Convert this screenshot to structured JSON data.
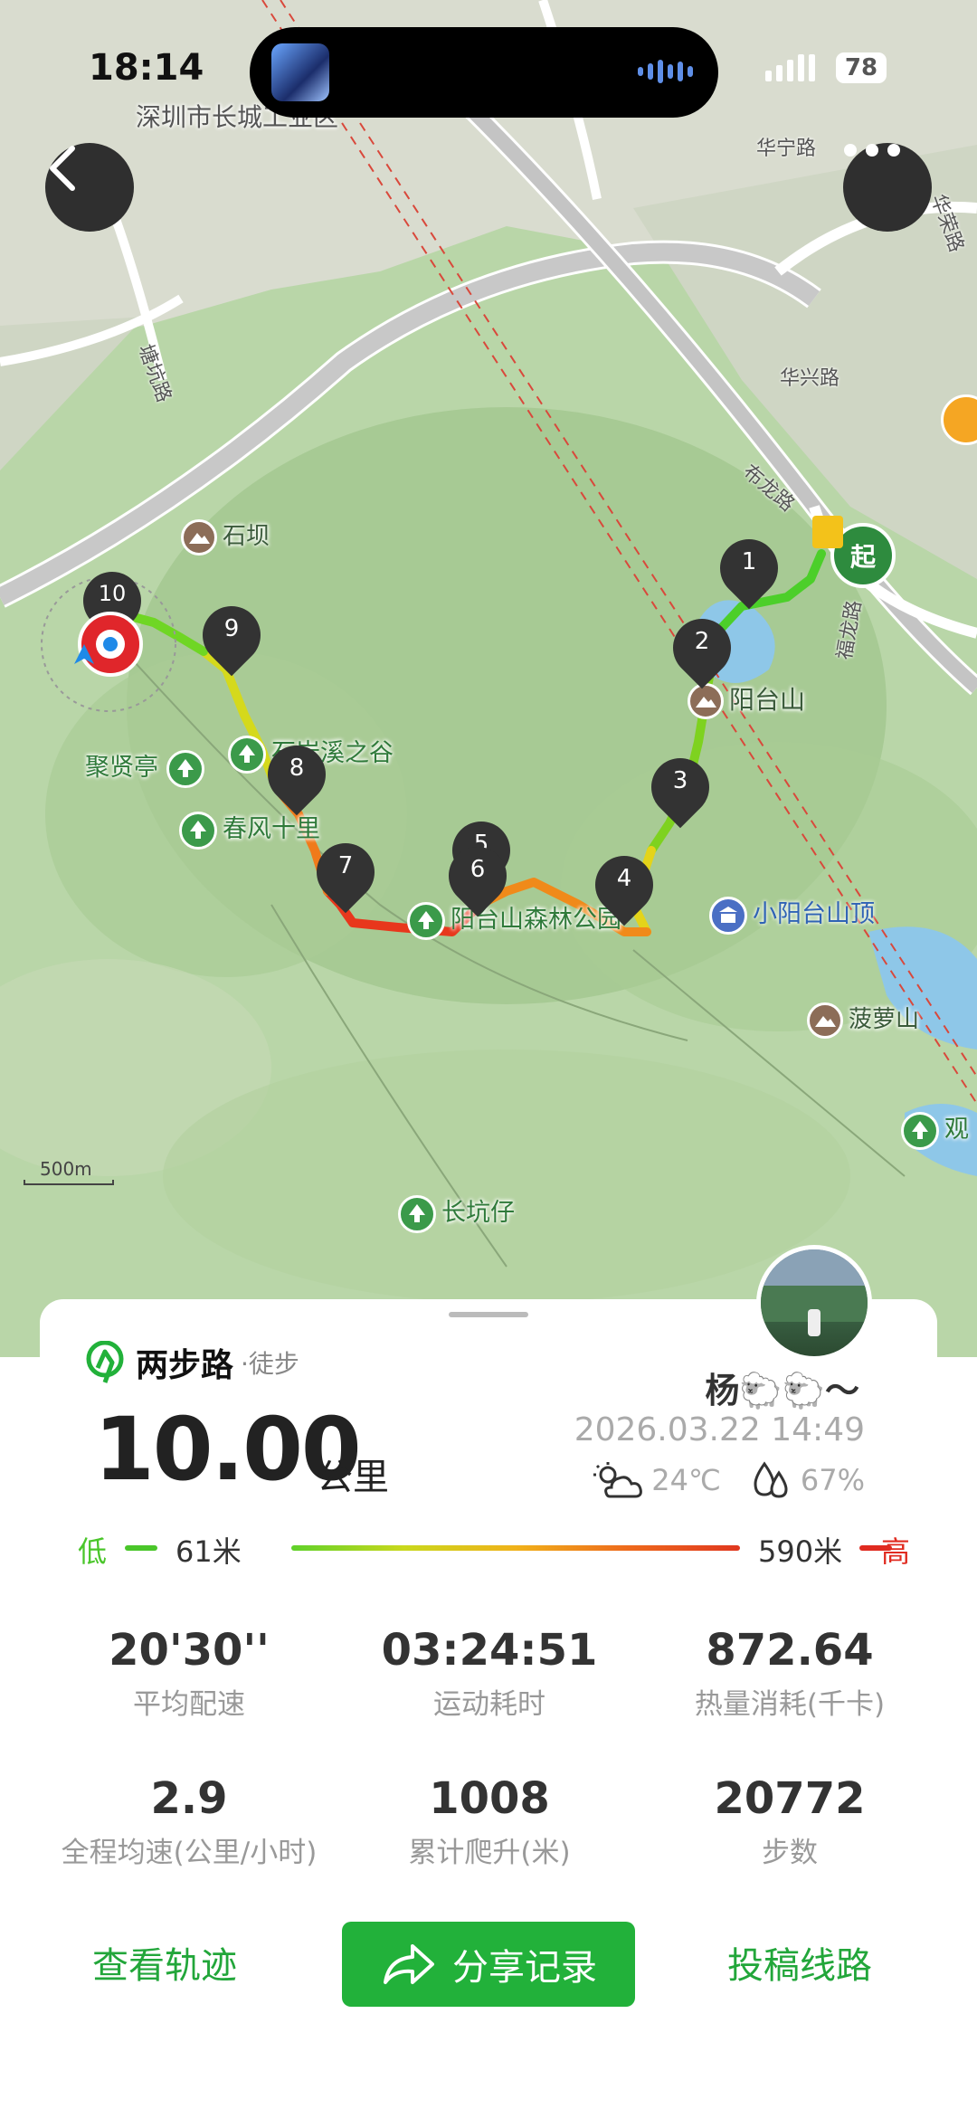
{
  "status_bar": {
    "time": "18:14",
    "battery": "78"
  },
  "map": {
    "top_label": "深圳市长城工业区",
    "roads": [
      "华宁路",
      "华荣路",
      "塘坑路",
      "华兴路",
      "布龙路",
      "福龙路"
    ],
    "places": {
      "shiba": "石坝",
      "juxianting": "聚贤亭",
      "shiyanxi": "石岩溪之谷",
      "chunfeng": "春风十里",
      "yangtaishan": "阳台山",
      "forest_park": "阳台山森林公园",
      "small_peak": "小阳台山顶",
      "boluo": "菠萝山",
      "changkeng": "长坑仔",
      "guan": "观"
    },
    "start_label": "起",
    "km_markers": [
      "1",
      "2",
      "3",
      "4",
      "5",
      "6",
      "7",
      "8",
      "9",
      "10"
    ],
    "scale": "500m",
    "icons": [
      "back-arrow-icon",
      "more-dots-icon",
      "location-icon",
      "mountain-icon",
      "park-icon",
      "viewpoint-icon"
    ]
  },
  "card": {
    "brand": "两步路",
    "sport": "·徒步",
    "distance": "10.00",
    "distance_unit": "公里",
    "user": "杨🐑🐑～",
    "datetime": "2026.03.22 14:49",
    "temperature": "24℃",
    "humidity": "67%",
    "elevation": {
      "low_label": "低",
      "low_value": "61米",
      "high_value": "590米",
      "high_label": "高"
    },
    "stats": [
      {
        "value": "20'30''",
        "label": "平均配速"
      },
      {
        "value": "03:24:51",
        "label": "运动耗时"
      },
      {
        "value": "872.64",
        "label": "热量消耗(千卡)"
      },
      {
        "value": "2.9",
        "label": "全程均速(公里/小时)"
      },
      {
        "value": "1008",
        "label": "累计爬升(米)"
      },
      {
        "value": "20772",
        "label": "步数"
      }
    ]
  },
  "bottom_bar": {
    "view_track": "查看轨迹",
    "share": "分享记录",
    "submit_route": "投稿线路"
  },
  "colors": {
    "brand_green": "#22b13a",
    "low": "#4ac62a",
    "high": "#e02b20"
  }
}
